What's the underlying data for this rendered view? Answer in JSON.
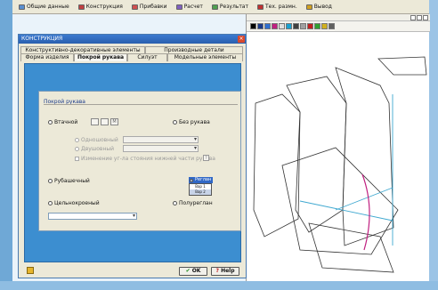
{
  "menu": {
    "items": [
      {
        "label": "Общие данные",
        "icon": "database-icon",
        "color": "#5a8fd0"
      },
      {
        "label": "Конструкция",
        "icon": "construct-icon",
        "color": "#c04040"
      },
      {
        "label": "Прибавки",
        "icon": "grid-icon",
        "color": "#d05050"
      },
      {
        "label": "Расчет",
        "icon": "calc-icon",
        "color": "#8060c0"
      },
      {
        "label": "Результат",
        "icon": "result-icon",
        "color": "#50a050"
      },
      {
        "label": "Тех. размн.",
        "icon": "tech-icon",
        "color": "#c03030"
      },
      {
        "label": "Вывод",
        "icon": "output-icon",
        "color": "#d0a020"
      }
    ]
  },
  "dialog": {
    "title": "КОНСТРУКЦИЯ",
    "close_glyph": "×",
    "tabs_row1": [
      {
        "label": "Конструктивно-декоративные элементы"
      },
      {
        "label": "Производные детали"
      }
    ],
    "tabs_row2": [
      {
        "label": "Форма изделия"
      },
      {
        "label": "Покрой рукава",
        "active": true
      },
      {
        "label": "Силуэт"
      },
      {
        "label": "Модельные элементы"
      }
    ],
    "group": {
      "title": "Покрой рукава",
      "options": {
        "vtachnoy": "Втачной",
        "bez_rukava": "Без рукава",
        "odnoshovny": "Одношовный",
        "dvushovny": "Двушовный",
        "checkbox_label": "Изменение уг-ла стояния нижней части рукава",
        "rubashechny": "Рубашечный",
        "reglan": "Реглан",
        "tselnokroeny": "Цельнокроеный",
        "polureglan": "Полуреглан"
      },
      "mini_buttons": [
        "",
        "",
        "M"
      ],
      "help_glyph": "?",
      "popup_items": [
        "Вар 1",
        "Вар 2"
      ]
    },
    "footer": {
      "ok_label": "OK",
      "ok_glyph": "✔",
      "help_label": "Help",
      "help_glyph": "?"
    }
  },
  "canvas": {
    "toolbar_colors": [
      "#000000",
      "#1a3a8a",
      "#2f6fd0",
      "#c02080",
      "#e0e0e0",
      "#1aa0d0",
      "#404040",
      "#a0a0a0",
      "#c02020",
      "#30a030",
      "#d0b020",
      "#606060"
    ]
  }
}
